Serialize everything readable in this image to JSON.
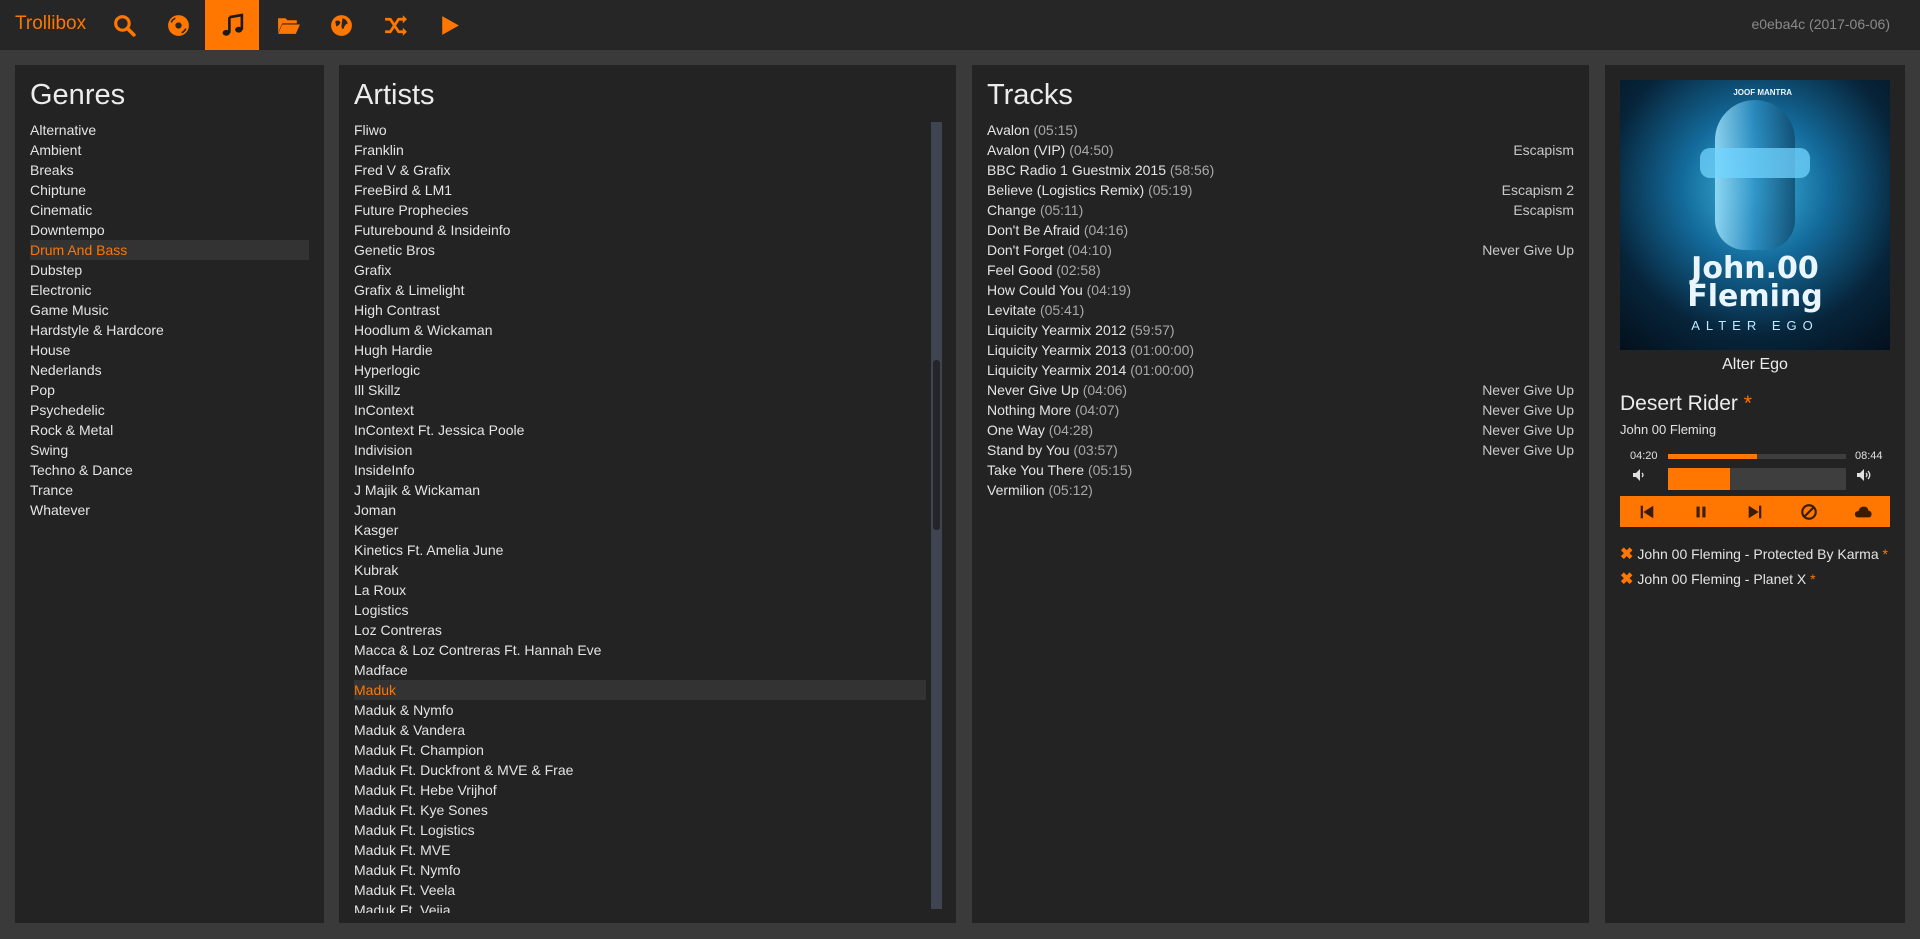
{
  "app": {
    "brand": "Trollibox",
    "version": "e0eba4c (2017-06-06)"
  },
  "nav": [
    {
      "icon": "search-icon"
    },
    {
      "icon": "disc-icon"
    },
    {
      "icon": "music-note-icon",
      "active": true
    },
    {
      "icon": "folder-open-icon"
    },
    {
      "icon": "globe-icon"
    },
    {
      "icon": "shuffle-icon"
    },
    {
      "icon": "play-icon"
    }
  ],
  "genres": {
    "title": "Genres",
    "selected": "Drum And Bass",
    "items": [
      "Alternative",
      "Ambient",
      "Breaks",
      "Chiptune",
      "Cinematic",
      "Downtempo",
      "Drum And Bass",
      "Dubstep",
      "Electronic",
      "Game Music",
      "Hardstyle & Hardcore",
      "House",
      "Nederlands",
      "Pop",
      "Psychedelic",
      "Rock & Metal",
      "Swing",
      "Techno & Dance",
      "Trance",
      "Whatever"
    ]
  },
  "artists": {
    "title": "Artists",
    "selected": "Maduk",
    "items": [
      "Fliwo",
      "Franklin",
      "Fred V & Grafix",
      "FreeBird & LM1",
      "Future Prophecies",
      "Futurebound & Insideinfo",
      "Genetic Bros",
      "Grafix",
      "Grafix & Limelight",
      "High Contrast",
      "Hoodlum & Wickaman",
      "Hugh Hardie",
      "Hyperlogic",
      "Ill Skillz",
      "InContext",
      "InContext Ft. Jessica Poole",
      "Indivision",
      "InsideInfo",
      "J Majik & Wickaman",
      "Joman",
      "Kasger",
      "Kinetics Ft. Amelia June",
      "Kubrak",
      "La Roux",
      "Logistics",
      "Loz Contreras",
      "Macca & Loz Contreras Ft. Hannah Eve",
      "Madface",
      "Maduk",
      "Maduk & Nymfo",
      "Maduk & Vandera",
      "Maduk Ft. Champion",
      "Maduk Ft. Duckfront & MVE & Frae",
      "Maduk Ft. Hebe Vrijhof",
      "Maduk Ft. Kye Sones",
      "Maduk Ft. Logistics",
      "Maduk Ft. MVE",
      "Maduk Ft. Nymfo",
      "Maduk Ft. Veela",
      "Maduk Ft. Veiia"
    ]
  },
  "tracks": {
    "title": "Tracks",
    "items": [
      {
        "title": "Avalon",
        "duration": "(05:15)",
        "album": ""
      },
      {
        "title": "Avalon (VIP)",
        "duration": "(04:50)",
        "album": "Escapism"
      },
      {
        "title": "BBC Radio 1 Guestmix 2015",
        "duration": "(58:56)",
        "album": ""
      },
      {
        "title": "Believe (Logistics Remix)",
        "duration": "(05:19)",
        "album": "Escapism 2"
      },
      {
        "title": "Change",
        "duration": "(05:11)",
        "album": "Escapism"
      },
      {
        "title": "Don't Be Afraid",
        "duration": "(04:16)",
        "album": ""
      },
      {
        "title": "Don't Forget",
        "duration": "(04:10)",
        "album": "Never Give Up"
      },
      {
        "title": "Feel Good",
        "duration": "(02:58)",
        "album": ""
      },
      {
        "title": "How Could You",
        "duration": "(04:19)",
        "album": ""
      },
      {
        "title": "Levitate",
        "duration": "(05:41)",
        "album": ""
      },
      {
        "title": "Liquicity Yearmix 2012",
        "duration": "(59:57)",
        "album": ""
      },
      {
        "title": "Liquicity Yearmix 2013",
        "duration": "(01:00:00)",
        "album": ""
      },
      {
        "title": "Liquicity Yearmix 2014",
        "duration": "(01:00:00)",
        "album": ""
      },
      {
        "title": "Never Give Up",
        "duration": "(04:06)",
        "album": "Never Give Up"
      },
      {
        "title": "Nothing More",
        "duration": "(04:07)",
        "album": "Never Give Up"
      },
      {
        "title": "One Way",
        "duration": "(04:28)",
        "album": "Never Give Up"
      },
      {
        "title": "Stand by You",
        "duration": "(03:57)",
        "album": "Never Give Up"
      },
      {
        "title": "Take You There",
        "duration": "(05:15)",
        "album": ""
      },
      {
        "title": "Vermilion",
        "duration": "(05:12)",
        "album": ""
      }
    ]
  },
  "player": {
    "cover": {
      "logo": "JOOF MANTRA",
      "artist_text": "John.00 Fleming",
      "subtitle": "ALTER EGO"
    },
    "album": "Alter Ego",
    "title": "Desert Rider",
    "star": "*",
    "artist": "John 00 Fleming",
    "elapsed": "04:20",
    "total": "08:44",
    "progress": 0.5,
    "volume": 0.35,
    "accent": "#ff7600"
  },
  "queue": [
    {
      "text": "John 00 Fleming - Protected By Karma",
      "star": "*"
    },
    {
      "text": "John 00 Fleming - Planet X",
      "star": "*"
    }
  ]
}
